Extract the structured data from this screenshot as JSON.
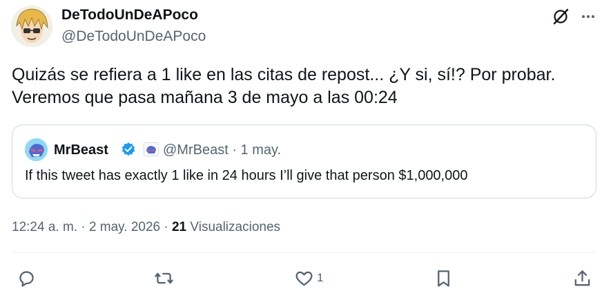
{
  "author": {
    "display_name": "DeTodoUnDeAPoco",
    "handle": "@DeTodoUnDeAPoco"
  },
  "tweet": {
    "lines": [
      "Quizás se refiera a 1 like en las citas de repost... ¿Y si, sí!? Por probar.",
      "Veremos que pasa mañana 3 de mayo a las 00:24"
    ]
  },
  "quoted": {
    "display_name": "MrBeast",
    "handle_and_date": "@MrBeast · 1 may.",
    "text": "If this tweet has exactly 1 like in 24 hours I’ll give that person $1,000,000"
  },
  "meta": {
    "time_date": "12:24 a. m. · 2 may. 2026 · ",
    "views_count": "21",
    "views_label": " Visualizaciones"
  },
  "actions": {
    "like_count": "1"
  },
  "colors": {
    "text_primary": "#0f1419",
    "text_secondary": "#536471",
    "border": "#cfd9de",
    "verified_blue": "#1d9bf0"
  },
  "icons": [
    "grok-icon",
    "more-icon",
    "reply-icon",
    "repost-icon",
    "like-icon",
    "bookmark-icon",
    "share-icon",
    "verified-badge-icon",
    "affiliate-badge-icon"
  ]
}
